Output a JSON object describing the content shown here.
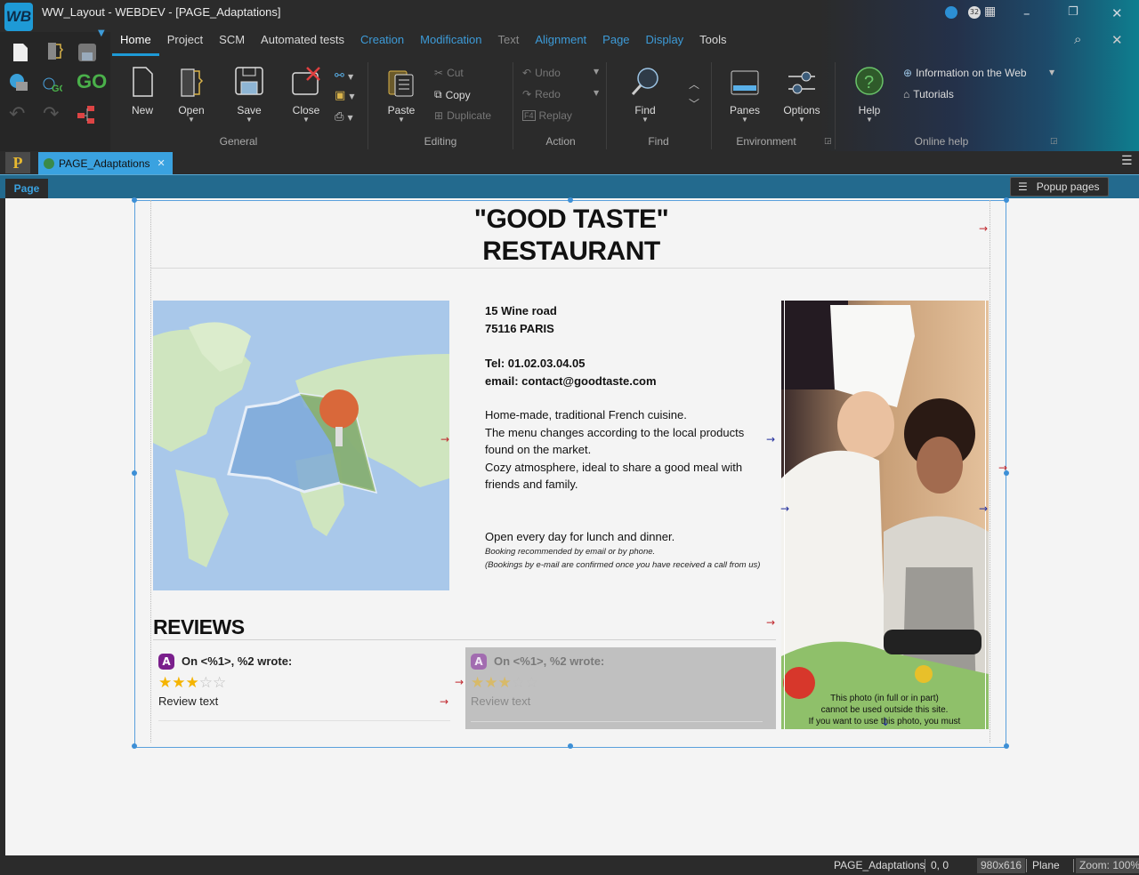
{
  "window": {
    "logo": "WB",
    "title": "WW_Layout - WEBDEV - [PAGE_Adaptations]",
    "controls": {
      "minimize": "–",
      "restore": "❐",
      "close": "✕"
    },
    "status_icons": [
      "b",
      "32",
      "▦"
    ]
  },
  "ribbon": {
    "tabs": [
      {
        "label": "Home",
        "state": "active"
      },
      {
        "label": "Project",
        "state": "normal"
      },
      {
        "label": "SCM",
        "state": "normal"
      },
      {
        "label": "Automated tests",
        "state": "normal"
      },
      {
        "label": "Creation",
        "state": "blue"
      },
      {
        "label": "Modification",
        "state": "blue"
      },
      {
        "label": "Text",
        "state": "dim"
      },
      {
        "label": "Alignment",
        "state": "blue"
      },
      {
        "label": "Page",
        "state": "blue"
      },
      {
        "label": "Display",
        "state": "blue"
      },
      {
        "label": "Tools",
        "state": "normal"
      }
    ],
    "groups": {
      "general": {
        "label": "General",
        "buttons": {
          "new": "New",
          "open": "Open",
          "save": "Save",
          "close": "Close"
        }
      },
      "editing": {
        "label": "Editing",
        "paste": "Paste",
        "cut": "Cut",
        "copy": "Copy",
        "duplicate": "Duplicate"
      },
      "action": {
        "label": "Action",
        "undo": "Undo",
        "redo": "Redo",
        "replay": "Replay"
      },
      "find": {
        "label": "Find",
        "find": "Find"
      },
      "environment": {
        "label": "Environment",
        "panes": "Panes",
        "options": "Options"
      },
      "online_help": {
        "label": "Online help",
        "help": "Help",
        "info_web": "Information on the Web",
        "tutorials": "Tutorials"
      }
    }
  },
  "doc_tabs": {
    "project_badge": "P",
    "active_tab": "PAGE_Adaptations"
  },
  "page_bar": {
    "page_tab": "Page",
    "popup_pages": "Popup pages"
  },
  "page": {
    "title_line1": "\"GOOD TASTE\"",
    "title_line2": "RESTAURANT",
    "address_line1": "15 Wine road",
    "address_line2": "75116 PARIS",
    "tel": "Tel: 01.02.03.04.05",
    "email": "email: contact@goodtaste.com",
    "desc1": "Home-made, traditional French cuisine.",
    "desc2": "The menu changes according to the local products found on the market.",
    "desc3": "Cozy atmosphere, ideal to share a good meal with friends and family.",
    "open": "Open every day for lunch and dinner.",
    "booking1": "Booking recommended by email or by phone.",
    "booking2": "(Bookings by e-mail are confirmed once you have received a call from us)",
    "photo_notice": "This photo (in full or in part) cannot be used outside this site. If you want to use this photo, you must",
    "reviews_heading": "REVIEWS",
    "reviews": [
      {
        "avatar": "A",
        "header": "On <%1>, %2 wrote:",
        "rating": 3,
        "max": 5,
        "text": "Review text",
        "greyed": false
      },
      {
        "avatar": "A",
        "header": "On <%1>, %2 wrote:",
        "rating": 3,
        "max": 5,
        "text": "Review text",
        "greyed": true
      }
    ]
  },
  "status_bar": {
    "page_name": "PAGE_Adaptations",
    "coords": "0, 0",
    "size": "980x616",
    "mode": "Plane",
    "zoom": "Zoom: 100%"
  },
  "colors": {
    "accent": "#1e9ad6",
    "page_bar": "#236a8e",
    "anchor_red": "#c0272d",
    "anchor_blue": "#1f2b9a",
    "avatar": "#7a1f8c",
    "star": "#f5b400"
  }
}
